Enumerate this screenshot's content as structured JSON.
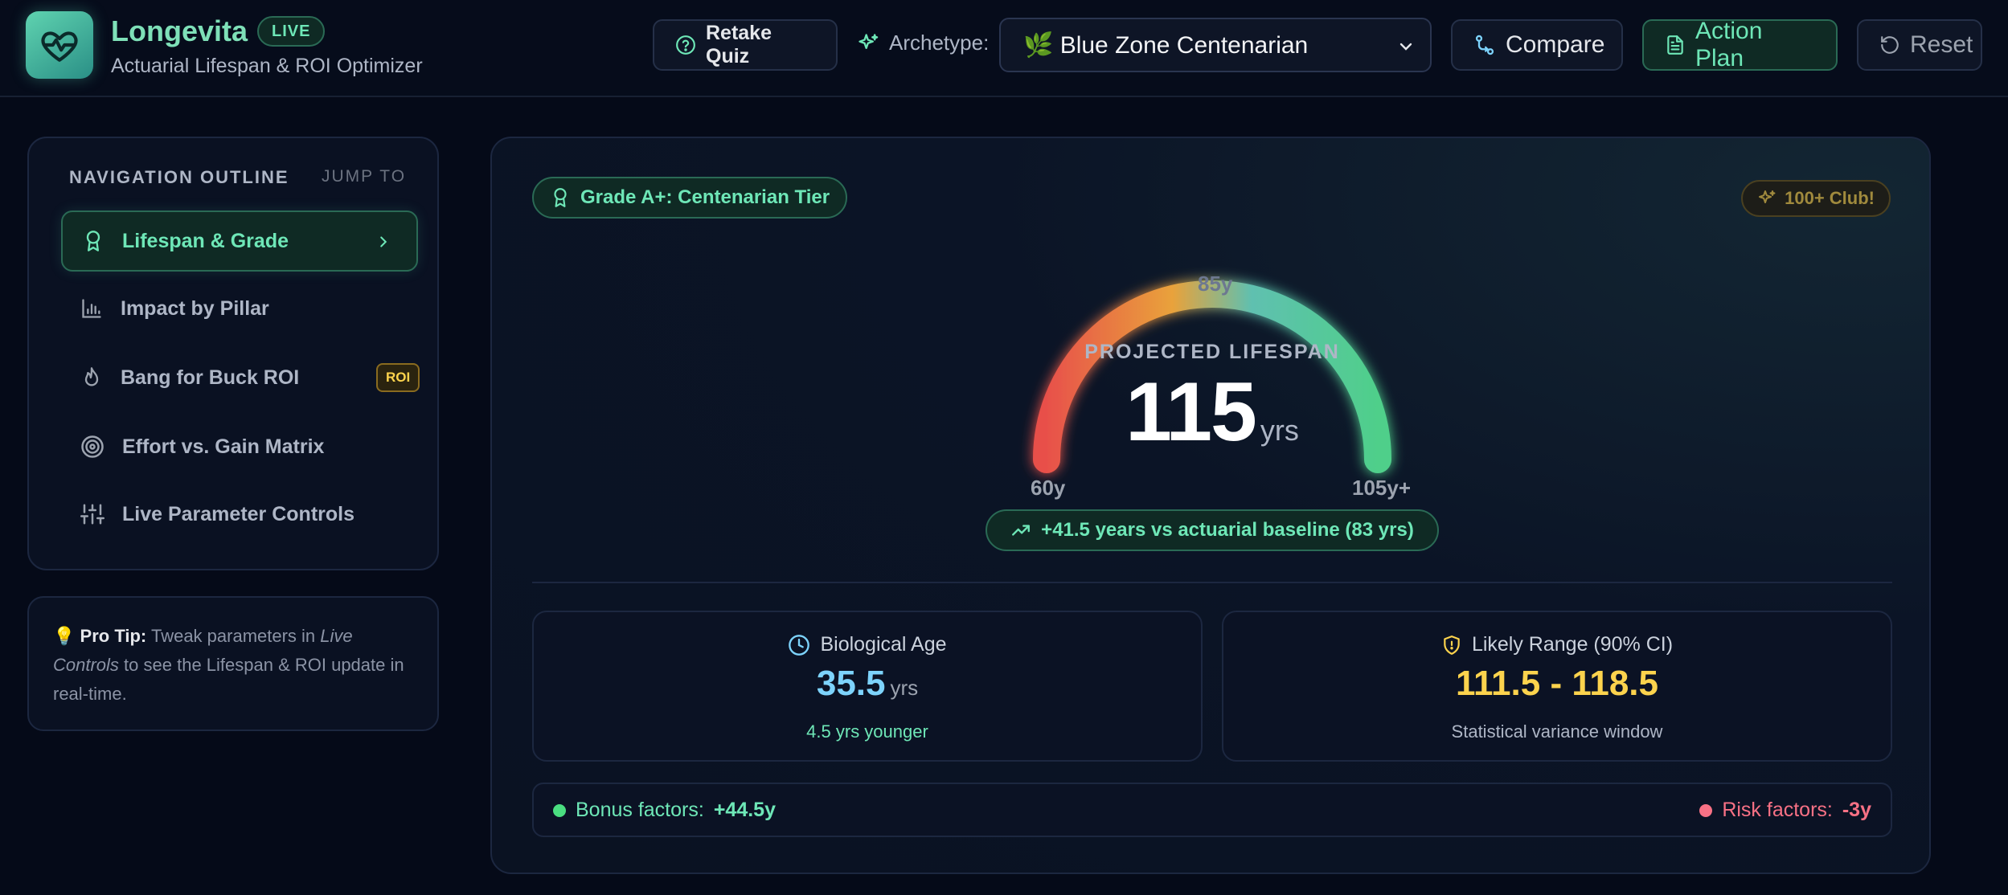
{
  "header": {
    "brand": "Longevita",
    "live_badge": "LIVE",
    "subtitle": "Actuarial Lifespan & ROI Optimizer",
    "retake_label": "Retake Quiz",
    "archetype_label": "Archetype:",
    "archetype_value": "🌿 Blue Zone Centenarian",
    "compare_label": "Compare",
    "action_plan_label": "Action Plan",
    "reset_label": "Reset"
  },
  "nav": {
    "title": "NAVIGATION OUTLINE",
    "jump": "JUMP TO",
    "items": [
      {
        "label": "Lifespan & Grade",
        "icon": "award-icon",
        "active": true
      },
      {
        "label": "Impact by Pillar",
        "icon": "bar-chart-icon"
      },
      {
        "label": "Bang for Buck ROI",
        "icon": "flame-icon",
        "tag": "ROI"
      },
      {
        "label": "Effort vs. Gain Matrix",
        "icon": "target-icon"
      },
      {
        "label": "Live Parameter Controls",
        "icon": "sliders-icon"
      }
    ]
  },
  "tip": {
    "emoji": "💡",
    "label": "Pro Tip:",
    "text_a": "Tweak parameters in",
    "text_em": "Live Controls",
    "text_b": "to see the Lifespan & ROI update in real-time."
  },
  "main": {
    "grade": "Grade A+: Centenarian Tier",
    "club": "100+ Club!",
    "gauge": {
      "caption": "PROJECTED LIFESPAN",
      "value": "115",
      "unit": "yrs",
      "min_label": "60y",
      "mid_label": "85y",
      "max_label": "105y+",
      "fill_fraction": 1.0
    },
    "baseline": "+41.5 years vs actuarial baseline (83 yrs)",
    "bio_age": {
      "title": "Biological Age",
      "value": "35.5",
      "unit": "yrs",
      "note": "4.5 yrs younger"
    },
    "range": {
      "title": "Likely Range (90% CI)",
      "value": "111.5 - 118.5",
      "note": "Statistical variance window"
    },
    "bonus": {
      "label": "Bonus factors:",
      "value": "+44.5y"
    },
    "risk": {
      "label": "Risk factors:",
      "value": "-3y"
    }
  },
  "colors": {
    "accent": "#6ee7b7",
    "bio": "#7dd3fc",
    "range": "#fcd34d",
    "risk": "#f87185"
  }
}
